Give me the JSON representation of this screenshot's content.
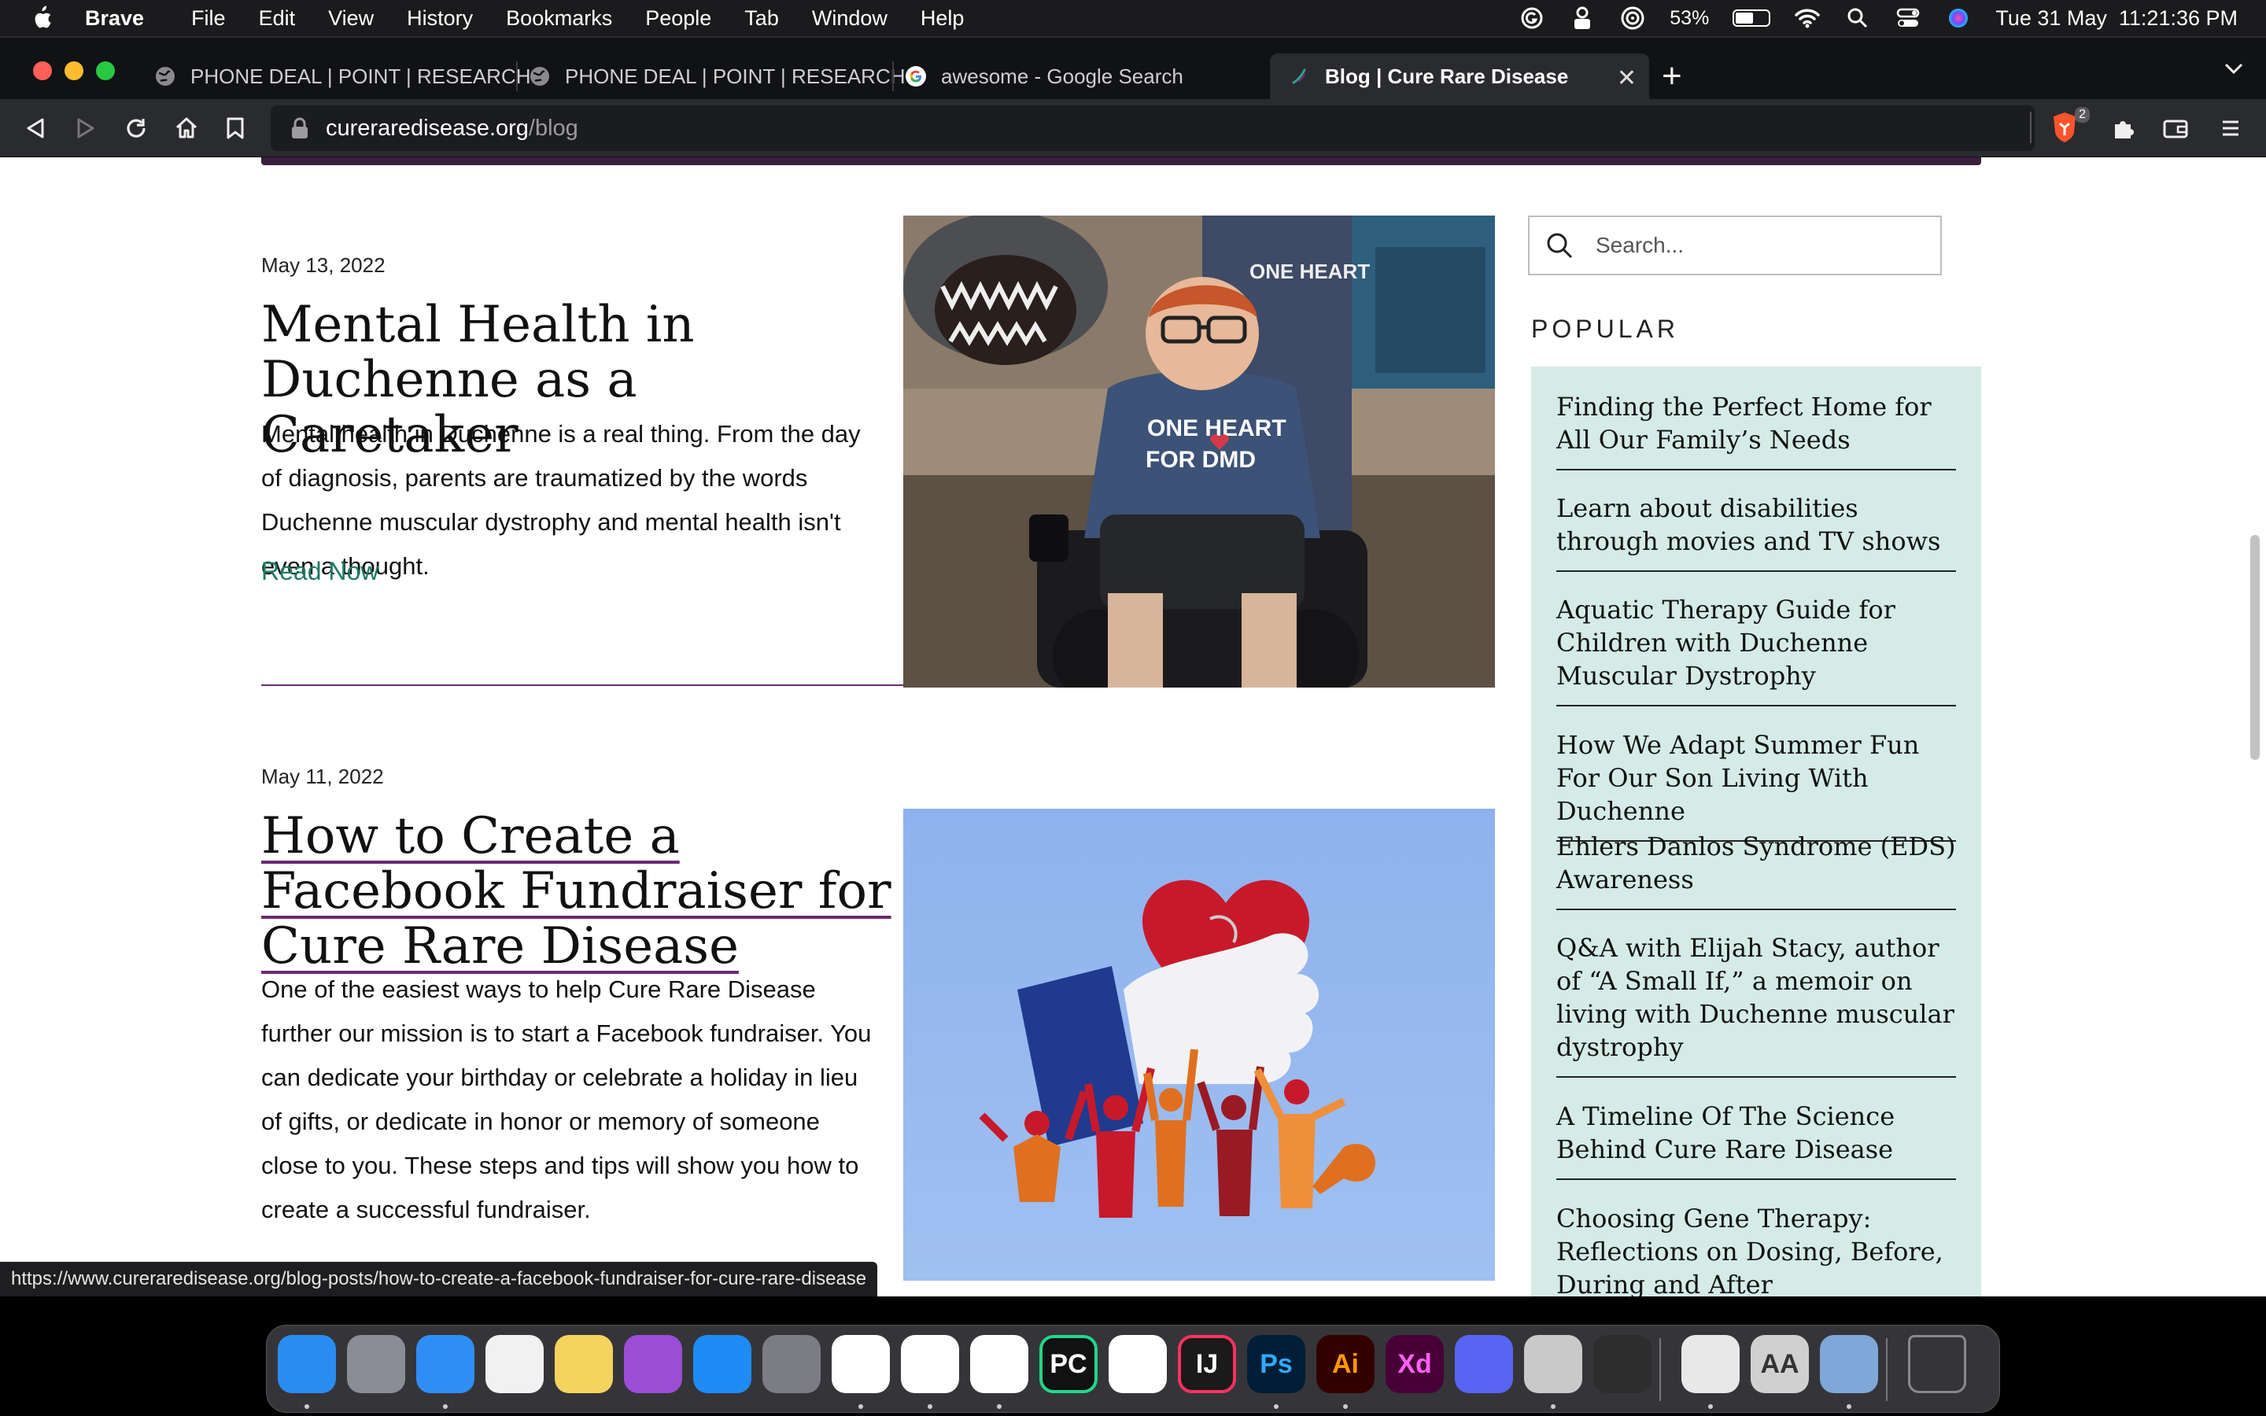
{
  "menubar": {
    "app_name": "Brave",
    "items": [
      "File",
      "Edit",
      "View",
      "History",
      "Bookmarks",
      "People",
      "Tab",
      "Window",
      "Help"
    ],
    "battery": "53%",
    "datetime": "Tue 31 May  11:21:36 PM"
  },
  "browser": {
    "tabs": [
      {
        "title": "PHONE DEAL | POINT | RESEARCH",
        "icon": "globe-icon"
      },
      {
        "title": "PHONE DEAL | POINT | RESEARCH",
        "icon": "globe-icon"
      },
      {
        "title": "awesome - Google Search",
        "icon": "google-icon"
      },
      {
        "title": "Blog | Cure Rare Disease",
        "icon": "site-icon",
        "active": true
      }
    ],
    "url_host": "cureraredisease.org",
    "url_path": "/blog",
    "shield_count": "2"
  },
  "posts": [
    {
      "date": "May 13, 2022",
      "title": "Mental Health in Duchenne as a Caretaker",
      "excerpt": "Mental health in Duchenne is a real thing. From the day of diagnosis, parents are traumatized by the words Duchenne muscular dystrophy and mental health isn't even a thought.",
      "read_more": "Read Now",
      "shirt_text_1": "ONE HEART",
      "shirt_text_2": "FOR DMD"
    },
    {
      "date": "May 11, 2022",
      "title": "How to Create a Facebook Fundraiser for Cure Rare Disease",
      "excerpt": "One of the easiest ways to help Cure Rare Disease further our mission is to start a Facebook fundraiser. You can dedicate your birthday or celebrate a holiday in lieu of gifts, or dedicate in honor or memory of someone close to you. These steps and tips will show you how to create a successful fundraiser."
    }
  ],
  "sidebar": {
    "search_placeholder": "Search...",
    "popular_heading": "POPULAR",
    "popular": [
      "Finding the Perfect Home for All Our Family’s Needs",
      "Learn about disabilities through movies and TV shows",
      "Aquatic Therapy Guide for Children with Duchenne Muscular Dystrophy",
      "How We Adapt Summer Fun For Our Son Living With Duchenne",
      "Ehlers Danlos Syndrome (EDS) Awareness",
      "Q&A with Elijah Stacy, author of “A Small If,” a memoir on living with Duchenne muscular dystrophy",
      "A Timeline Of The Science Behind Cure Rare Disease",
      "Choosing Gene Therapy: Reflections on Dosing, Before, During and After"
    ]
  },
  "status_url": "https://www.cureraredisease.org/blog-posts/how-to-create-a-facebook-fundraiser-for-cure-rare-disease",
  "dock": {
    "apps": [
      {
        "name": "finder-icon",
        "label": "",
        "color": "#2a8cf0"
      },
      {
        "name": "launchpad-icon",
        "label": "",
        "color": "#8a8d96"
      },
      {
        "name": "safari-icon",
        "label": "",
        "color": "#2f8ef5"
      },
      {
        "name": "photos-icon",
        "label": "",
        "color": "#f1f1f1"
      },
      {
        "name": "notes-icon",
        "label": "",
        "color": "#f4d35e"
      },
      {
        "name": "podcasts-icon",
        "label": "",
        "color": "#9b4dd6"
      },
      {
        "name": "app-store-icon",
        "label": "",
        "color": "#1f8bf4"
      },
      {
        "name": "system-preferences-icon",
        "label": "",
        "color": "#7b7d83"
      },
      {
        "name": "brave-icon",
        "label": "",
        "color": "#ffffff"
      },
      {
        "name": "chrome-icon",
        "label": "",
        "color": "#ffffff"
      },
      {
        "name": "vscode-icon",
        "label": "",
        "color": "#ffffff"
      },
      {
        "name": "pycharm-icon",
        "label": "PC",
        "color": "#21d789"
      },
      {
        "name": "instruments-icon",
        "label": "",
        "color": "#ffffff"
      },
      {
        "name": "intellij-icon",
        "label": "IJ",
        "color": "#1a1a1a"
      },
      {
        "name": "photoshop-icon",
        "label": "Ps",
        "color": "#001e36"
      },
      {
        "name": "illustrator-icon",
        "label": "Ai",
        "color": "#330000"
      },
      {
        "name": "xd-icon",
        "label": "Xd",
        "color": "#470137"
      },
      {
        "name": "discord-icon",
        "label": "",
        "color": "#5865f2"
      },
      {
        "name": "disk-utility-icon",
        "label": "",
        "color": "#c9c9c9"
      },
      {
        "name": "final-cut-icon",
        "label": "",
        "color": "#2d2d2d"
      },
      {
        "name": "emoji-app-icon",
        "label": "",
        "color": "#e8e8e8"
      },
      {
        "name": "font-book-icon",
        "label": "AA",
        "color": "#d0d0d0"
      },
      {
        "name": "preview-icon",
        "label": "",
        "color": "#7fa7d8"
      },
      {
        "name": "trash-icon",
        "label": "",
        "color": "#6b6b6b"
      }
    ]
  }
}
